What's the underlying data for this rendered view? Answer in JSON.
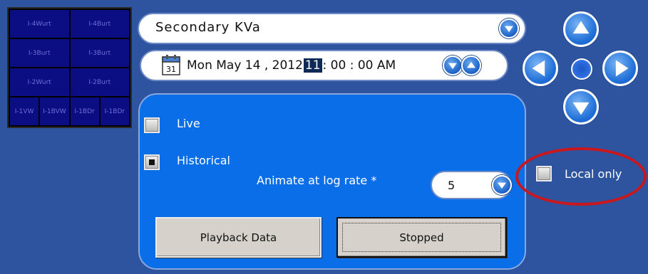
{
  "grid": {
    "rows": [
      [
        "I-4Wurt",
        "I-4Burt"
      ],
      [
        "I-3Burt",
        "I-3Burt"
      ],
      [
        "I-2Wurt",
        "I-2Burt"
      ],
      [
        "I-1VW",
        "I-1BVW",
        "I-1BDr",
        "I-1BDr"
      ]
    ]
  },
  "metric_select": {
    "value": "Secondary  KVa"
  },
  "datetime": {
    "calendar_day": "31",
    "date_text": "Mon May 14 , 2012 ",
    "hour": "11",
    "rest": ": 00 : 00 AM"
  },
  "mode": {
    "live_label": "Live",
    "historical_label": "Historical",
    "animate_label": "Animate at log rate *",
    "rate_value": "5"
  },
  "buttons": {
    "playback_label": "Playback Data",
    "stopped_label": "Stopped"
  },
  "local_only_label": "Local only",
  "colors": {
    "background": "#2e54a0",
    "panel": "#0a6ee8",
    "highlight": "#0c2a55",
    "annotation": "#c8181e"
  }
}
